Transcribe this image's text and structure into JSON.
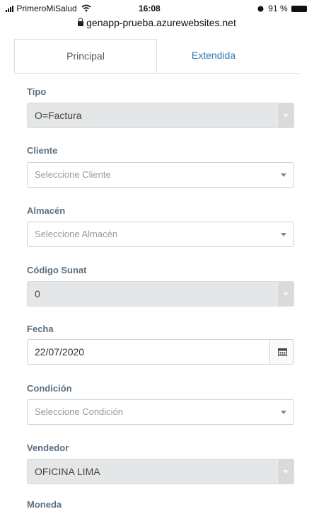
{
  "status_bar": {
    "carrier": "PrimeroMiSalud",
    "time": "16:08",
    "battery": "91 %"
  },
  "browser": {
    "url": "genapp-prueba.azurewebsites.net"
  },
  "tabs": [
    {
      "label": "Principal",
      "active": true
    },
    {
      "label": "Extendida",
      "active": false
    }
  ],
  "form": {
    "tipo": {
      "label": "Tipo",
      "value": "O=Factura"
    },
    "cliente": {
      "label": "Cliente",
      "placeholder": "Seleccione Cliente"
    },
    "almacen": {
      "label": "Almacén",
      "placeholder": "Seleccione Almacén"
    },
    "codigo_sunat": {
      "label": "Código Sunat",
      "value": "0"
    },
    "fecha": {
      "label": "Fecha",
      "value": "22/07/2020"
    },
    "condicion": {
      "label": "Condición",
      "placeholder": "Seleccione Condición"
    },
    "vendedor": {
      "label": "Vendedor",
      "value": "OFICINA LIMA"
    },
    "moneda": {
      "label": "Moneda"
    }
  },
  "icons": [
    "wifi-icon",
    "lock-icon",
    "calendar-icon",
    "chevron-down-icon"
  ]
}
